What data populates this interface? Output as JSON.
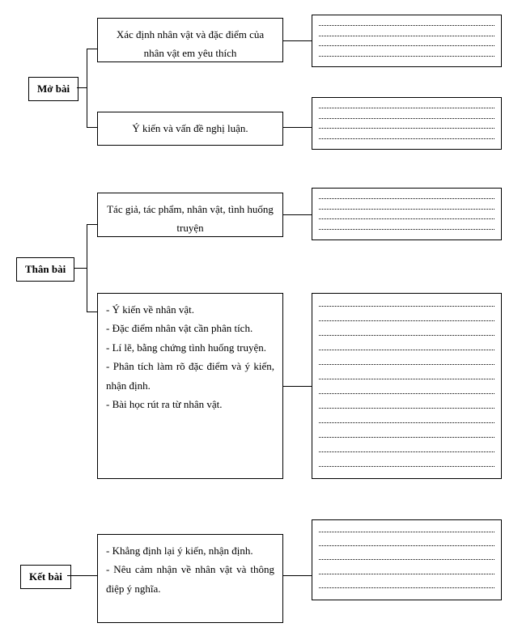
{
  "sections": {
    "mobai": {
      "label": "Mở bài",
      "box1": "Xác định nhân vật và đặc điểm của nhân vật em yêu thích",
      "box2": "Ý kiến và vấn đề nghị luận."
    },
    "thanbai": {
      "label": "Thân bài",
      "box1": "Tác giả, tác phẩm, nhân vật, tình huống truyện",
      "box2_line1": "- Ý kiến về nhân vật.",
      "box2_line2": "- Đặc điểm nhân vật cần phân tích.",
      "box2_line3": "- Lí lẽ, bằng chứng tình huống truyện.",
      "box2_line4": "- Phân tích làm rõ đặc điểm và ý kiến, nhận định.",
      "box2_line5": "- Bài học rút ra từ nhân vật."
    },
    "ketbai": {
      "label": "Kết bài",
      "box1_line1": "- Khẳng định lại ý kiến, nhận định.",
      "box1_line2": "- Nêu cảm nhận về nhân vật và thông điệp ý nghĩa."
    }
  }
}
